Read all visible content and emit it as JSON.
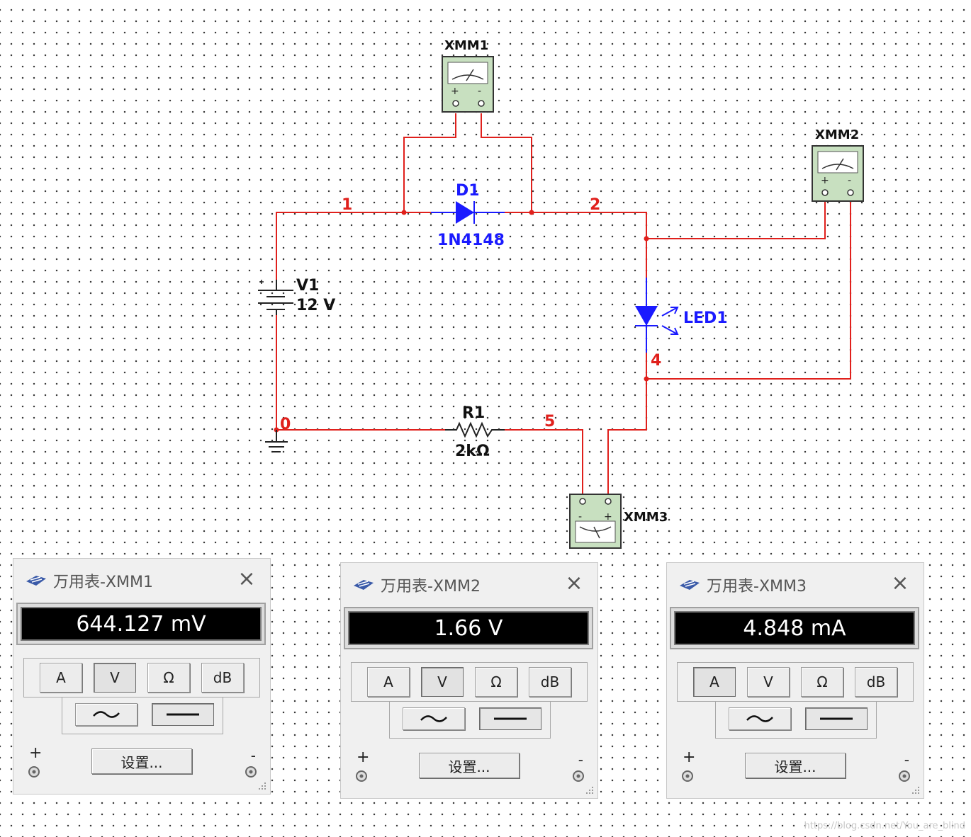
{
  "schematic": {
    "meters": {
      "xmm1": "XMM1",
      "xmm2": "XMM2",
      "xmm3": "XMM3"
    },
    "diode": {
      "ref": "D1",
      "model": "1N4148"
    },
    "source": {
      "ref": "V1",
      "value": "12 V"
    },
    "led": {
      "ref": "LED1"
    },
    "resistor": {
      "ref": "R1",
      "value": "2kΩ"
    },
    "nets": {
      "n0": "0",
      "n1": "1",
      "n2": "2",
      "n4": "4",
      "n5": "5"
    },
    "colors": {
      "wire": "#e0201c",
      "component": "#1a1aff",
      "meter_body": "#c8e0c0"
    }
  },
  "multimeters": [
    {
      "title": "万用表-XMM1",
      "reading": "644.127 mV",
      "mode_buttons": [
        "A",
        "V",
        "Ω",
        "dB"
      ],
      "active_mode": "V",
      "signal_buttons": [
        "ac-wave-icon",
        "dc-line-icon"
      ],
      "active_signal": "dc-line-icon",
      "settings_label": "设置...",
      "plus_label": "+",
      "minus_label": "-"
    },
    {
      "title": "万用表-XMM2",
      "reading": "1.66 V",
      "mode_buttons": [
        "A",
        "V",
        "Ω",
        "dB"
      ],
      "active_mode": "V",
      "signal_buttons": [
        "ac-wave-icon",
        "dc-line-icon"
      ],
      "active_signal": "dc-line-icon",
      "settings_label": "设置...",
      "plus_label": "+",
      "minus_label": "-"
    },
    {
      "title": "万用表-XMM3",
      "reading": "4.848 mA",
      "mode_buttons": [
        "A",
        "V",
        "Ω",
        "dB"
      ],
      "active_mode": "A",
      "signal_buttons": [
        "ac-wave-icon",
        "dc-line-icon"
      ],
      "active_signal": "dc-line-icon",
      "settings_label": "设置...",
      "plus_label": "+",
      "minus_label": "-"
    }
  ],
  "watermark": "https://blog.csdn.net/You_are_blind"
}
